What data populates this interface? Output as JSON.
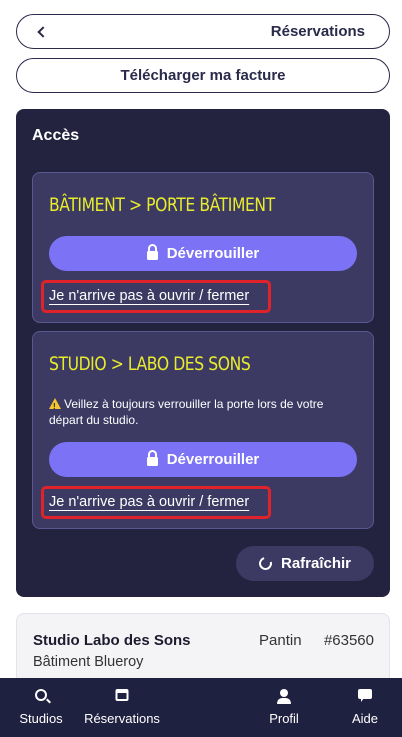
{
  "header": {
    "back_label": "Réservations",
    "invoice_label": "Télécharger ma facture"
  },
  "access": {
    "title": "Accès",
    "doors": [
      {
        "name": "BÂTIMENT > PORTE BÂTIMENT",
        "unlock_label": "Déverrouiller",
        "issue_link": "Je n'arrive pas à ouvrir / fermer"
      },
      {
        "name": "STUDIO > LABO DES SONS",
        "warning": "Veillez à toujours verrouiller la porte lors de votre départ du studio.",
        "unlock_label": "Déverrouiller",
        "issue_link": "Je n'arrive pas à ouvrir / fermer"
      }
    ],
    "refresh_label": "Rafraîchir"
  },
  "booking": {
    "studio_name": "Studio Labo des Sons",
    "building": "Bâtiment Blueroy",
    "city": "Pantin",
    "id": "#63560"
  },
  "nav": {
    "items": [
      {
        "label": "Studios",
        "icon": "search-pin-icon"
      },
      {
        "label": "Réservations",
        "icon": "calendar-icon"
      },
      {
        "label": "Profil",
        "icon": "user-icon"
      },
      {
        "label": "Aide",
        "icon": "chat-icon"
      }
    ]
  },
  "colors": {
    "panel_bg": "#24233f",
    "card_bg": "#3c3a63",
    "accent": "#7b72f5",
    "door_name": "#e8ec2c",
    "highlight": "#e0222a",
    "nav_bg": "#1f2140"
  }
}
